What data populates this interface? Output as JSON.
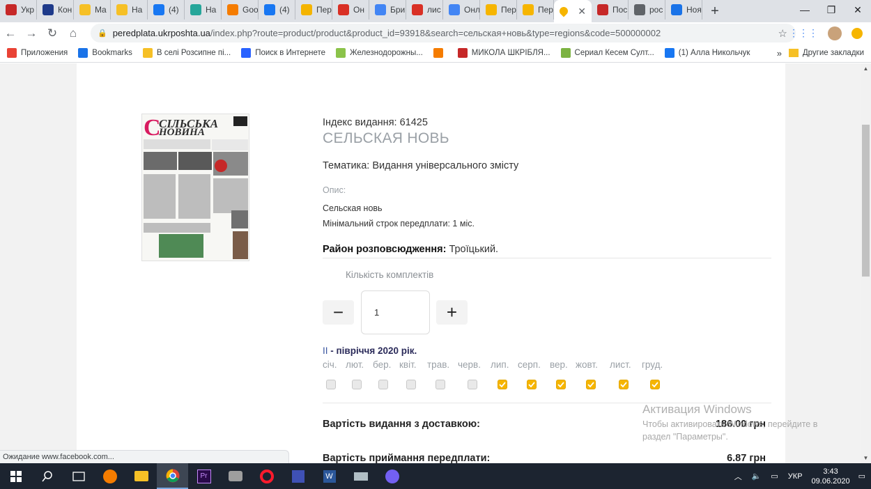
{
  "browser": {
    "tabs": [
      {
        "label": "Укр",
        "icon": "ukr-icon",
        "color": "#c62828"
      },
      {
        "label": "Кон",
        "icon": "cloud-icon",
        "color": "#1e3a8a"
      },
      {
        "label": "Ma",
        "icon": "yellow-circle-icon",
        "color": "#f6c026"
      },
      {
        "label": "На",
        "icon": "yellow-circle-icon",
        "color": "#f6c026"
      },
      {
        "label": "(4)",
        "icon": "facebook-icon",
        "color": "#1877f2"
      },
      {
        "label": "На",
        "icon": "globe-icon",
        "color": "#26a69a"
      },
      {
        "label": "Goo",
        "icon": "analytics-icon",
        "color": "#f57c00"
      },
      {
        "label": "(4)",
        "icon": "facebook-icon",
        "color": "#1877f2"
      },
      {
        "label": "Пер",
        "icon": "m-icon",
        "color": "#f4b400"
      },
      {
        "label": "Он",
        "icon": "gmail-icon",
        "color": "#d93025"
      },
      {
        "label": "Бри",
        "icon": "docs-icon",
        "color": "#4285f4"
      },
      {
        "label": "лис",
        "icon": "gmail-icon",
        "color": "#d93025"
      },
      {
        "label": "Онл",
        "icon": "docs-icon",
        "color": "#4285f4"
      },
      {
        "label": "Пер",
        "icon": "pin-icon",
        "color": "#f6b500"
      },
      {
        "label": "Пер",
        "icon": "pin-icon",
        "color": "#f6b500"
      },
      {
        "label": "Пос",
        "icon": "ukrposhta-icon",
        "color": "#c62828"
      },
      {
        "label": "poc",
        "icon": "globe-icon",
        "color": "#5f6368"
      },
      {
        "label": "Ноя",
        "icon": "shield-icon",
        "color": "#1a73e8"
      }
    ],
    "active_tab_icon_color": "#f6b500",
    "url_host": "peredplata.ukrposhta.ua",
    "url_path": "/index.php?route=product/product&product_id=93918&search=сельская+новь&type=regions&code=500000002",
    "bookmarks": [
      {
        "label": "Приложения",
        "icon": "apps-icon",
        "color": "#e94235"
      },
      {
        "label": "Bookmarks",
        "icon": "star-icon",
        "color": "#1a73e8"
      },
      {
        "label": "В селі Розсипне пі...",
        "icon": "yellow-circle-icon",
        "color": "#f6c026"
      },
      {
        "label": "Поиск в Интернете",
        "icon": "search-icon",
        "color": "#2962ff"
      },
      {
        "label": "Железнодорожны...",
        "icon": "rail-icon",
        "color": "#8bc34a"
      },
      {
        "label": "",
        "icon": "ok-icon",
        "color": "#f57c00"
      },
      {
        "label": "МИКОЛА ШКРІБЛЯ...",
        "icon": "ukr-icon",
        "color": "#c62828"
      },
      {
        "label": "Сериал Кесем Султ...",
        "icon": "tv-icon",
        "color": "#7cb342"
      },
      {
        "label": "(1) Алла Никольчук",
        "icon": "facebook-icon",
        "color": "#1877f2"
      }
    ],
    "bookmarks_more": "»",
    "other_bookmarks": "Другие закладки",
    "status_text": "Ожидание www.facebook.com..."
  },
  "product": {
    "index_label": "Індекс видання: 61425",
    "title": "СЕЛЬСКАЯ НОВЬ",
    "theme": "Тематика: Видання універсального змісту",
    "description_label": "Опис:",
    "description": "Сельская новь",
    "min_term": "Мінімальний строк передплати: 1 міс.",
    "district_label": "Район розповсюдження:",
    "district_value": " Троїцький.",
    "cover": {
      "masthead_top": "СІЛЬСЬКА",
      "masthead_bottom": "НОВИНА"
    }
  },
  "quantity": {
    "label": "Кількість комплектів",
    "minus": "−",
    "plus": "+",
    "value": "1"
  },
  "period": {
    "prefix": "II",
    "label": " - півріччя 2020 рік.",
    "months": [
      {
        "name": "січ.",
        "checked": false
      },
      {
        "name": "лют.",
        "checked": false
      },
      {
        "name": "бер.",
        "checked": false
      },
      {
        "name": "квіт.",
        "checked": false
      },
      {
        "name": "трав.",
        "checked": false
      },
      {
        "name": "черв.",
        "checked": false
      },
      {
        "name": "лип.",
        "checked": true
      },
      {
        "name": "серп.",
        "checked": true
      },
      {
        "name": "вер.",
        "checked": true
      },
      {
        "name": "жовт.",
        "checked": true
      },
      {
        "name": "лист.",
        "checked": true
      },
      {
        "name": "груд.",
        "checked": true
      }
    ],
    "check_color": "#f6b500"
  },
  "costs": {
    "delivery_label": "Вартість видання з доставкою:",
    "delivery_value": "186.00 грн",
    "fee_label": "Вартість приймання передплати:",
    "fee_value": "6.87 грн"
  },
  "watermark": {
    "line1": "Активация Windows",
    "line2": "Чтобы активировать Windows, перейдите в",
    "line3": "раздел \"Параметры\"."
  },
  "taskbar": {
    "language": "УКР",
    "time": "3:43",
    "date": "09.06.2020"
  }
}
